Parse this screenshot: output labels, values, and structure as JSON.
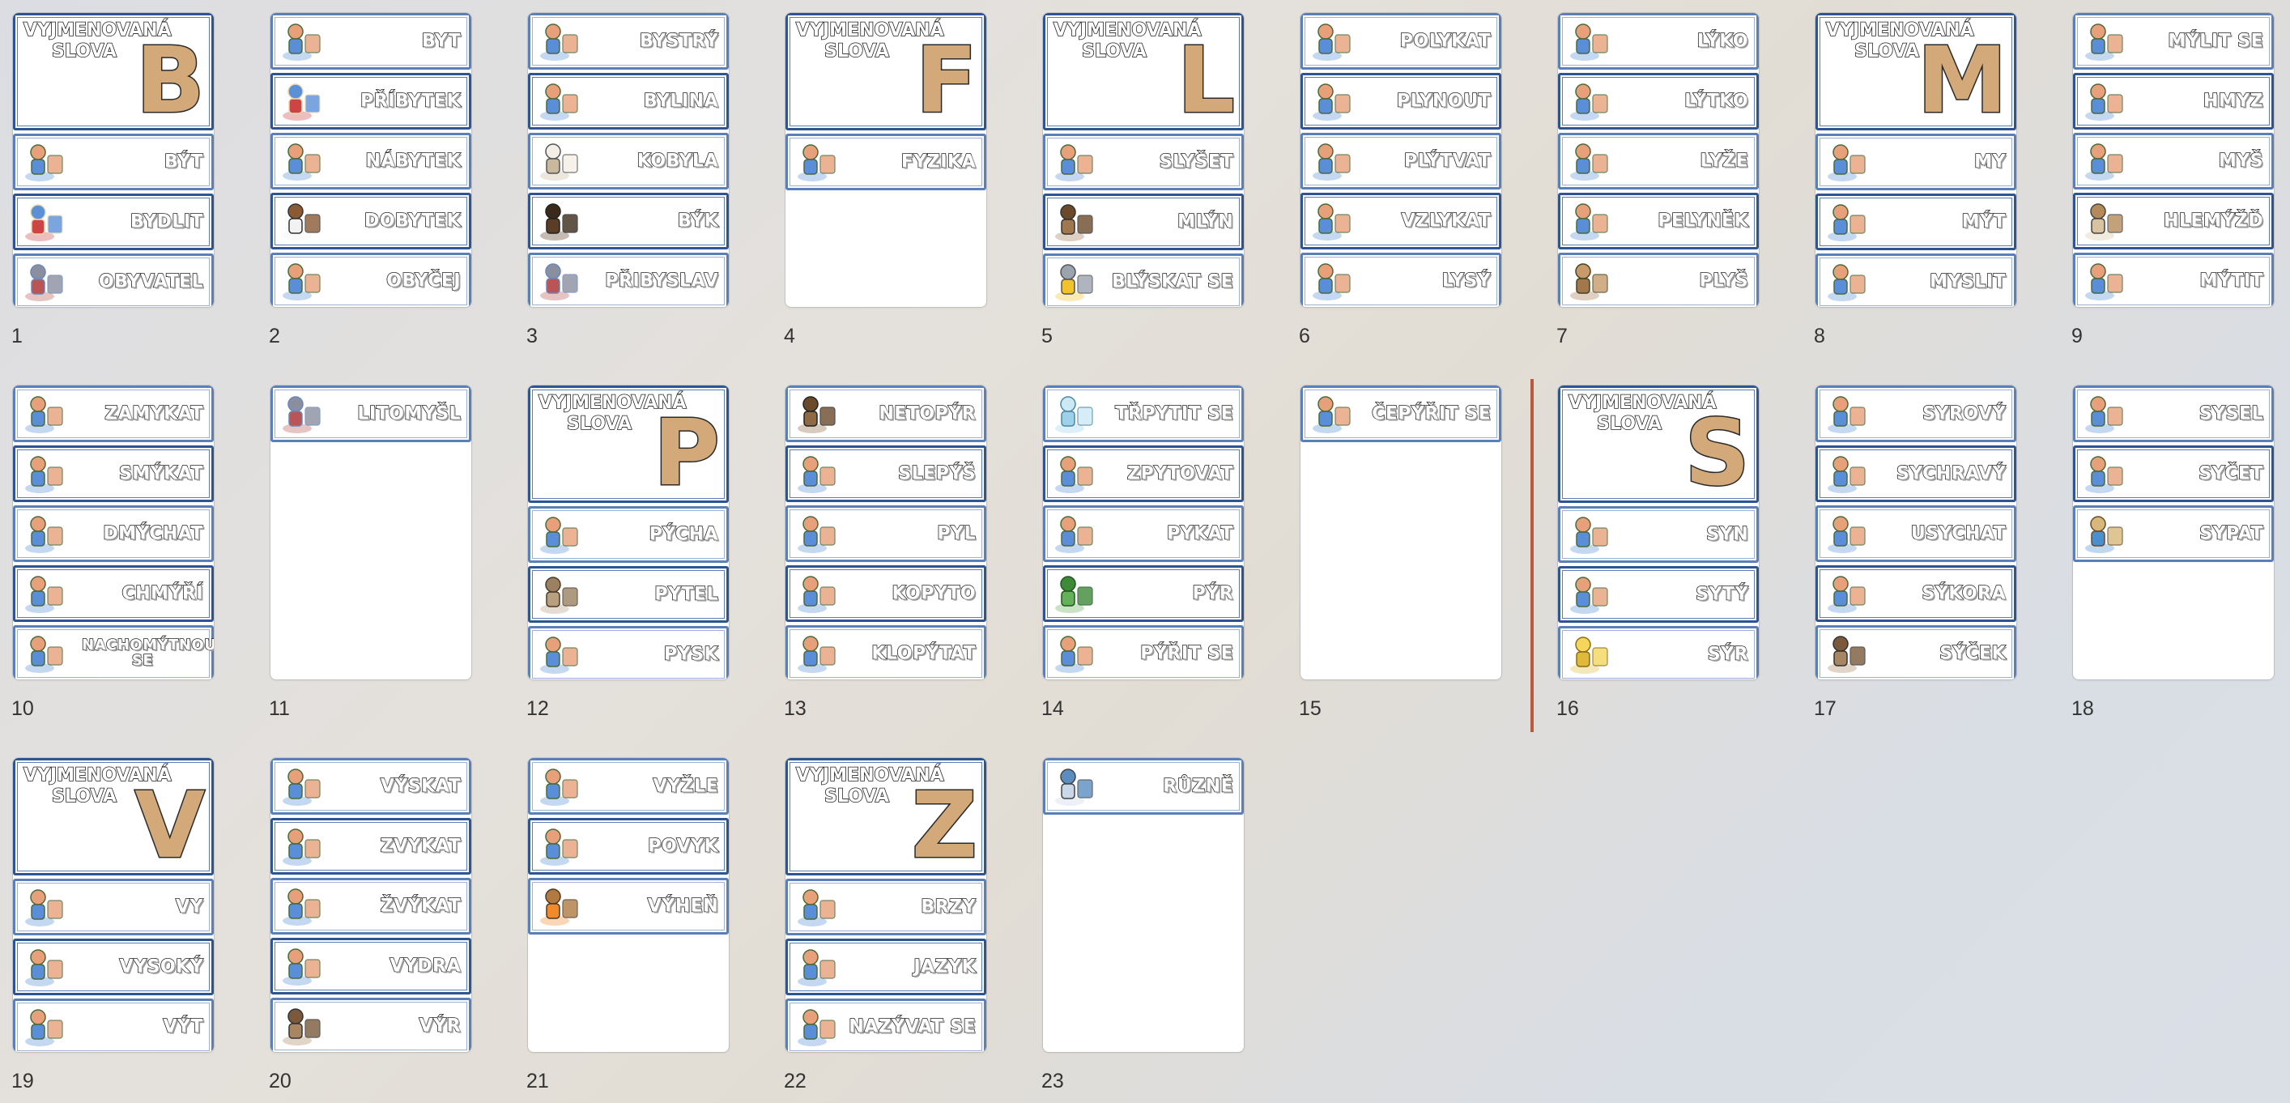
{
  "header_title": "VYJMENOVANÁ SLOVA",
  "slides": [
    {
      "num": "1",
      "letter": "B",
      "cards": [
        {
          "label": "BÝT",
          "icon": "couple-icon"
        },
        {
          "label": "BYDLIT",
          "icon": "house-icon"
        },
        {
          "label": "OBYVATEL",
          "icon": "townsperson-icon"
        }
      ]
    },
    {
      "num": "2",
      "cards": [
        {
          "label": "BYT",
          "icon": "apartment-room-icon"
        },
        {
          "label": "PŘÍBYTEK",
          "icon": "doghouse-icon"
        },
        {
          "label": "NÁBYTEK",
          "icon": "furniture-icon"
        },
        {
          "label": "DOBYTEK",
          "icon": "cattle-icon"
        },
        {
          "label": "OBYČEJ",
          "icon": "christmas-tree-icon"
        }
      ]
    },
    {
      "num": "3",
      "cards": [
        {
          "label": "BYSTRÝ",
          "icon": "boy-cat-icon"
        },
        {
          "label": "BYLINA",
          "icon": "chamomile-icon"
        },
        {
          "label": "KOBYLA",
          "icon": "horse-icon"
        },
        {
          "label": "BÝK",
          "icon": "bull-icon"
        },
        {
          "label": "PŘIBYSLAV",
          "icon": "town-icon"
        }
      ]
    },
    {
      "num": "4",
      "letter": "F",
      "cards": [
        {
          "label": "FYZIKA",
          "icon": "scientist-magnet-icon"
        }
      ]
    },
    {
      "num": "5",
      "letter": "L",
      "cards": [
        {
          "label": "SLYŠET",
          "icon": "child-listening-icon"
        },
        {
          "label": "MLÝN",
          "icon": "windmill-icon"
        },
        {
          "label": "BLÝSKAT SE",
          "icon": "storm-cloud-icon"
        }
      ]
    },
    {
      "num": "6",
      "cards": [
        {
          "label": "POLYKAT",
          "icon": "child-drinking-icon"
        },
        {
          "label": "PLYNOUT",
          "icon": "river-clock-icon"
        },
        {
          "label": "PLÝTVAT",
          "icon": "child-trash-icon"
        },
        {
          "label": "VZLYKAT",
          "icon": "crying-children-icon"
        },
        {
          "label": "LYSÝ",
          "icon": "bald-man-icon"
        }
      ]
    },
    {
      "num": "7",
      "cards": [
        {
          "label": "LÝKO",
          "icon": "tree-stump-icon"
        },
        {
          "label": "LÝTKO",
          "icon": "leg-icon"
        },
        {
          "label": "LYŽE",
          "icon": "skier-icon"
        },
        {
          "label": "PELYNĚK",
          "icon": "wormwood-icon"
        },
        {
          "label": "PLYŠ",
          "icon": "teddy-bear-icon"
        }
      ]
    },
    {
      "num": "8",
      "letter": "M",
      "cards": [
        {
          "label": "MY",
          "icon": "couple-icon"
        },
        {
          "label": "MÝT",
          "icon": "washing-dishes-icon"
        },
        {
          "label": "MYSLIT",
          "icon": "thinking-child-icon"
        }
      ]
    },
    {
      "num": "9",
      "cards": [
        {
          "label": "MÝLIT SE",
          "icon": "wrong-answer-icon"
        },
        {
          "label": "HMYZ",
          "icon": "insects-icon"
        },
        {
          "label": "MYŠ",
          "icon": "mouse-icon"
        },
        {
          "label": "HLEMÝŽĎ",
          "icon": "snail-icon"
        },
        {
          "label": "MÝTIT",
          "icon": "axe-tree-icon"
        }
      ]
    },
    {
      "num": "10",
      "cards": [
        {
          "label": "ZAMYKAT",
          "icon": "padlock-icon"
        },
        {
          "label": "SMÝKAT",
          "icon": "skid-sign-car-icon"
        },
        {
          "label": "DMÝCHAT",
          "icon": "blowing-child-icon"
        },
        {
          "label": "CHMÝŘÍ",
          "icon": "dandelion-fluff-icon"
        },
        {
          "label": "NACHOMÝTNOUT SE",
          "icon": "child-toy-car-icon"
        }
      ]
    },
    {
      "num": "11",
      "cards": [
        {
          "label": "LITOMYŠL",
          "icon": "town-buildings-icon"
        }
      ]
    },
    {
      "num": "12",
      "letter": "P",
      "cards": [
        {
          "label": "PÝCHA",
          "icon": "princess-icon"
        },
        {
          "label": "PYTEL",
          "icon": "sack-icon"
        },
        {
          "label": "PYSK",
          "icon": "llama-mouth-icon"
        }
      ]
    },
    {
      "num": "13",
      "cards": [
        {
          "label": "NETOPÝR",
          "icon": "bat-icon"
        },
        {
          "label": "SLEPÝŠ",
          "icon": "slow-worm-icon"
        },
        {
          "label": "PYL",
          "icon": "bee-flowers-icon"
        },
        {
          "label": "KOPYTO",
          "icon": "hooves-icon"
        },
        {
          "label": "KLOPÝTAT",
          "icon": "wheelchair-child-icon"
        }
      ]
    },
    {
      "num": "14",
      "cards": [
        {
          "label": "TŘPYTIT SE",
          "icon": "diamond-icon"
        },
        {
          "label": "ZPYTOVAT",
          "icon": "thinking-boy-icon"
        },
        {
          "label": "PYKAT",
          "icon": "prison-icon"
        },
        {
          "label": "PÝR",
          "icon": "grass-icon"
        },
        {
          "label": "PÝŘIT SE",
          "icon": "shy-children-icon"
        }
      ]
    },
    {
      "num": "15",
      "cards": [
        {
          "label": "ČEPÝŘIT SE",
          "icon": "birds-icon"
        }
      ]
    },
    {
      "num": "16",
      "letter": "S",
      "cards": [
        {
          "label": "SYN",
          "icon": "father-son-icon"
        },
        {
          "label": "SYTÝ",
          "icon": "full-child-icon"
        },
        {
          "label": "SÝR",
          "icon": "cheese-icon"
        }
      ]
    },
    {
      "num": "17",
      "cards": [
        {
          "label": "SYROVÝ",
          "icon": "vegetables-icon"
        },
        {
          "label": "SYCHRAVÝ",
          "icon": "umbrella-child-icon"
        },
        {
          "label": "USYCHAT",
          "icon": "drying-icon"
        },
        {
          "label": "SÝKORA",
          "icon": "tit-bird-icon"
        },
        {
          "label": "SÝČEK",
          "icon": "owl-icon"
        }
      ]
    },
    {
      "num": "18",
      "cards": [
        {
          "label": "SYSEL",
          "icon": "ground-squirrel-icon"
        },
        {
          "label": "SYČET",
          "icon": "snake-icon"
        },
        {
          "label": "SYPAT",
          "icon": "hourglass-icon"
        }
      ]
    },
    {
      "num": "19",
      "letter": "V",
      "cards": [
        {
          "label": "VY",
          "icon": "group-of-kids-icon"
        },
        {
          "label": "VYSOKÝ",
          "icon": "tall-short-icon"
        },
        {
          "label": "VÝT",
          "icon": "wolf-moon-icon"
        }
      ]
    },
    {
      "num": "20",
      "cards": [
        {
          "label": "VÝSKAT",
          "icon": "cheering-kids-icon"
        },
        {
          "label": "ZVYKAT",
          "icon": "kids-habit-icon"
        },
        {
          "label": "ŽVÝKAT",
          "icon": "chewing-boy-icon"
        },
        {
          "label": "VYDRA",
          "icon": "otter-icon"
        },
        {
          "label": "VÝR",
          "icon": "eagle-owl-icon"
        }
      ]
    },
    {
      "num": "21",
      "cards": [
        {
          "label": "VYŽLE",
          "icon": "dog-icon"
        },
        {
          "label": "POVYK",
          "icon": "shouting-kids-icon"
        },
        {
          "label": "VÝHEŇ",
          "icon": "forge-icon"
        }
      ]
    },
    {
      "num": "22",
      "letter": "Z",
      "cards": [
        {
          "label": "BRZY",
          "icon": "alarm-clock-girl-icon"
        },
        {
          "label": "JAZYK",
          "icon": "tongue-icon"
        },
        {
          "label": "NAZÝVAT SE",
          "icon": "name-tag-child-icon"
        }
      ]
    },
    {
      "num": "23",
      "cards": [
        {
          "label": "RŮZNĚ",
          "icon": "airport-icon"
        }
      ]
    }
  ]
}
